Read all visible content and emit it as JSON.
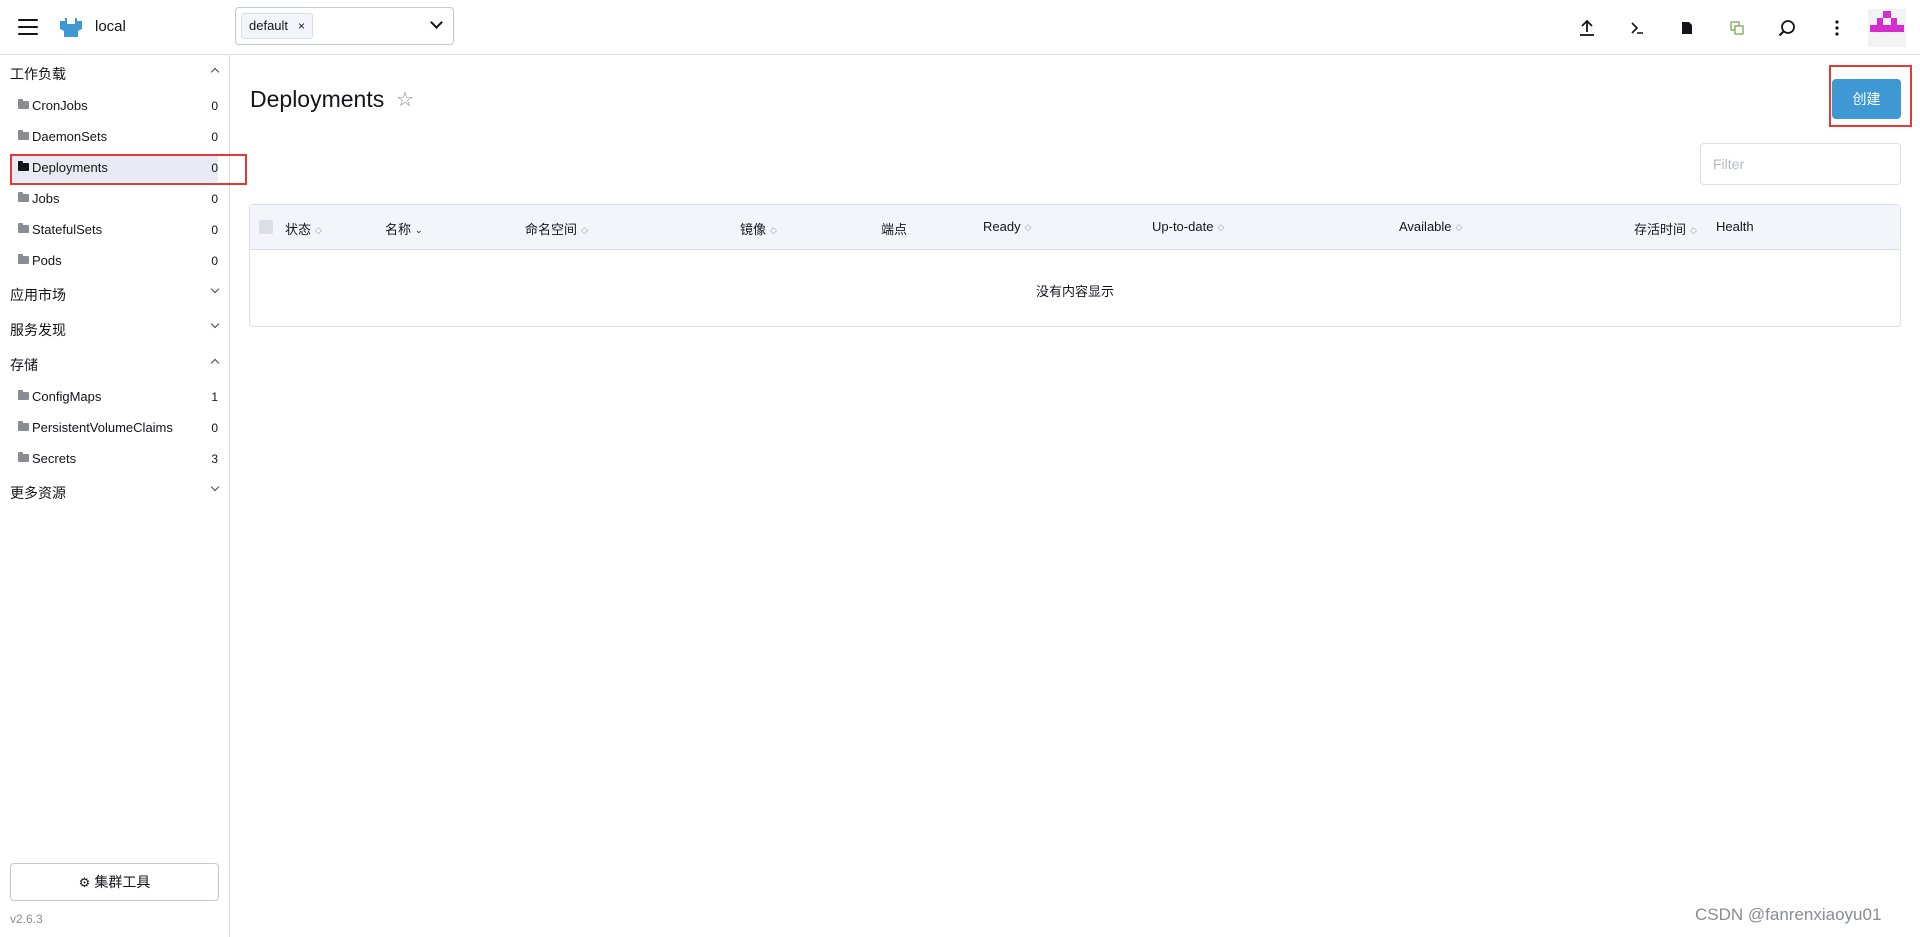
{
  "header": {
    "cluster_name": "local",
    "namespace_tag": "default",
    "namespace_tag_close": "×",
    "icons": [
      "upload-icon",
      "terminal-icon",
      "file-icon",
      "copy-icon",
      "search-icon",
      "more-icon"
    ]
  },
  "sidebar": {
    "groups": [
      {
        "title": "工作负载",
        "expanded": true
      },
      {
        "title": "应用市场",
        "expanded": false
      },
      {
        "title": "服务发现",
        "expanded": false
      },
      {
        "title": "存储",
        "expanded": true
      },
      {
        "title": "更多资源",
        "expanded": false
      }
    ],
    "workload_items": [
      {
        "label": "CronJobs",
        "count": "0"
      },
      {
        "label": "DaemonSets",
        "count": "0"
      },
      {
        "label": "Deployments",
        "count": "0",
        "active": true
      },
      {
        "label": "Jobs",
        "count": "0"
      },
      {
        "label": "StatefulSets",
        "count": "0"
      },
      {
        "label": "Pods",
        "count": "0"
      }
    ],
    "storage_items": [
      {
        "label": "ConfigMaps",
        "count": "1"
      },
      {
        "label": "PersistentVolumeClaims",
        "count": "0"
      },
      {
        "label": "Secrets",
        "count": "3"
      }
    ],
    "cluster_tools_label": "集群工具",
    "version": "v2.6.3"
  },
  "main": {
    "title": "Deployments",
    "create_label": "创建",
    "filter_placeholder": "Filter",
    "columns": [
      "状态",
      "名称",
      "命名空间",
      "镜像",
      "端点",
      "Ready",
      "Up-to-date",
      "Available",
      "存活时间",
      "Health"
    ],
    "empty_text": "没有内容显示"
  },
  "watermark": "CSDN @fanrenxiaoyu01",
  "colors": {
    "accent": "#3d98d3",
    "highlight_box": "#e53935",
    "active_nav_bg": "#e8ebf3"
  }
}
